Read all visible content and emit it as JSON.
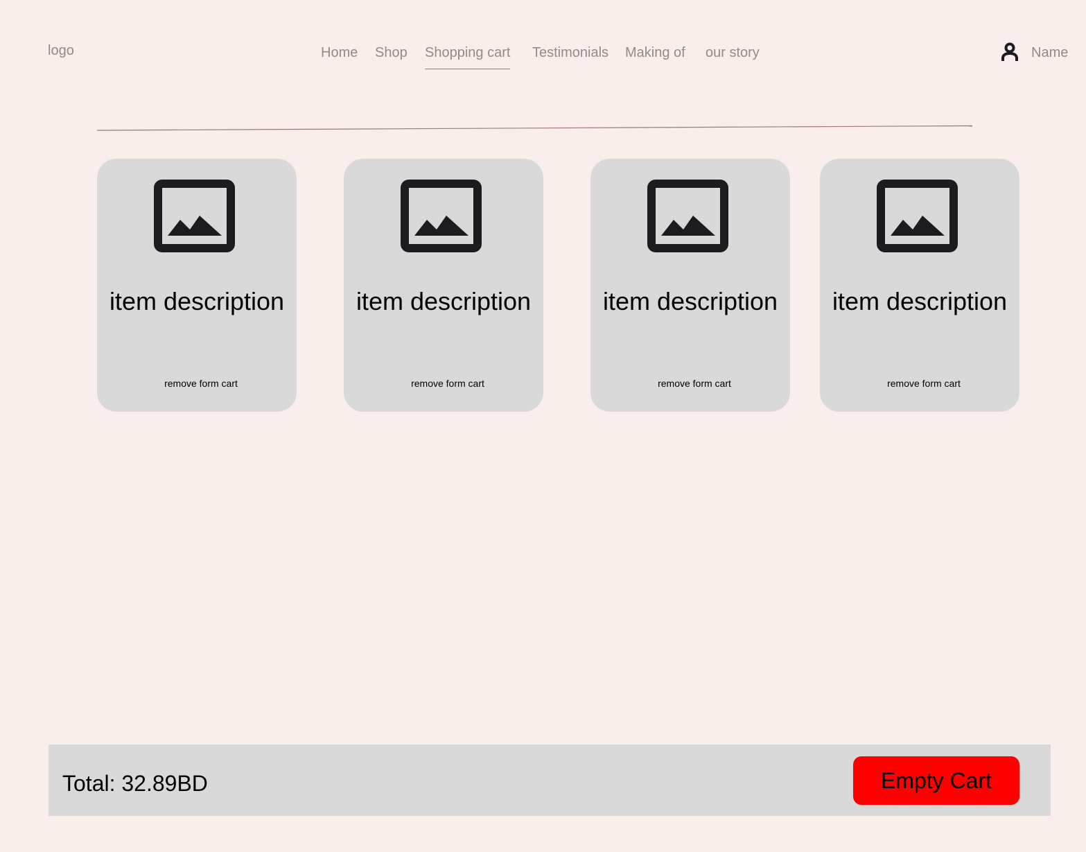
{
  "header": {
    "logo": "logo",
    "nav": [
      {
        "label": "Home"
      },
      {
        "label": "Shop"
      },
      {
        "label": "Shopping cart",
        "active": true
      },
      {
        "label": "Testimonials"
      },
      {
        "label": "Making of"
      },
      {
        "label": "our story"
      }
    ],
    "user": {
      "icon": "user-icon",
      "name": "Name"
    }
  },
  "cart": {
    "items": [
      {
        "icon": "image-placeholder-icon",
        "description": "item description",
        "remove_label": "remove form cart"
      },
      {
        "icon": "image-placeholder-icon",
        "description": "item description",
        "remove_label": "remove form cart"
      },
      {
        "icon": "image-placeholder-icon",
        "description": "item description",
        "remove_label": "remove form cart"
      },
      {
        "icon": "image-placeholder-icon",
        "description": "item description",
        "remove_label": "remove form cart"
      }
    ]
  },
  "footer": {
    "total": "Total: 32.89BD",
    "empty_cart_label": "Empty Cart"
  },
  "colors": {
    "background": "#f9eeec",
    "card": "#d9d9d9",
    "nav_text": "#9a8787",
    "danger": "#ff0000"
  }
}
